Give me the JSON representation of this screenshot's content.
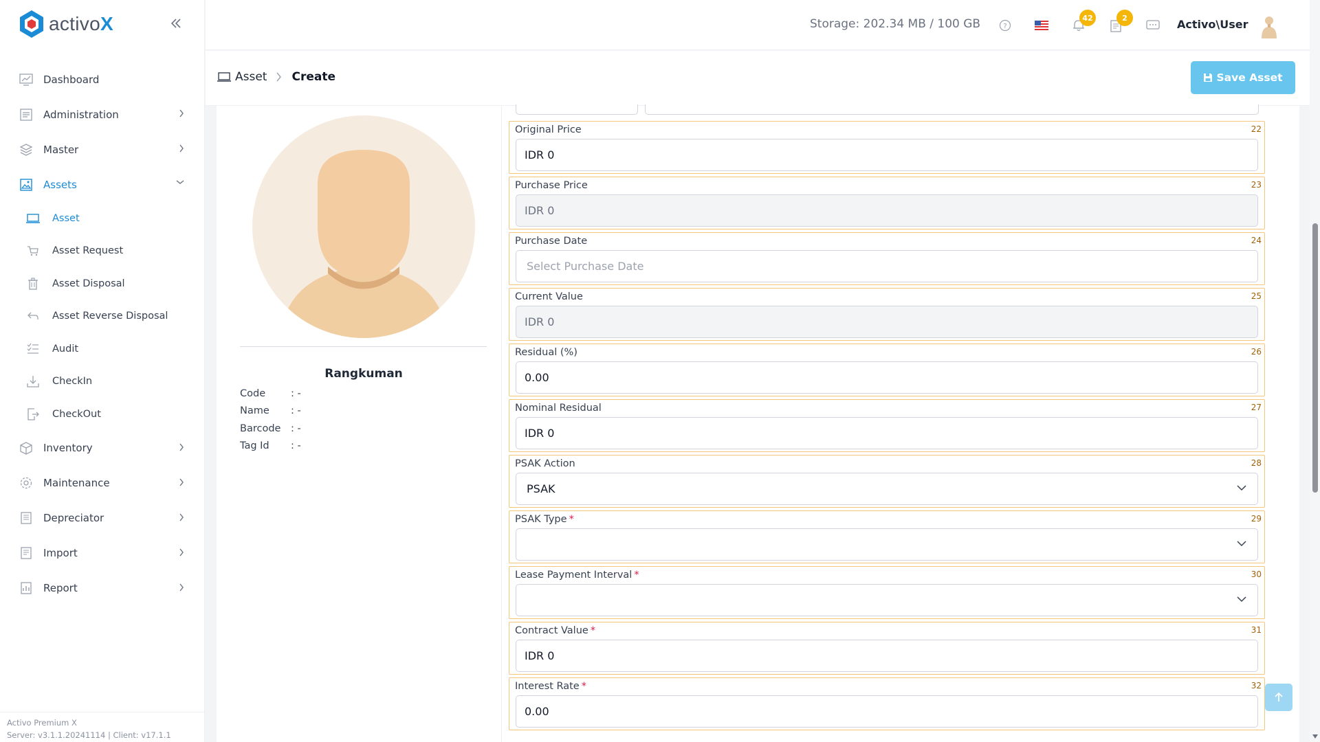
{
  "app": {
    "logo_text": "activo",
    "logo_x": "X",
    "brand_color": "#1c8bd6"
  },
  "header": {
    "storage": "Storage: 202.34 MB / 100 GB",
    "notifications_count": "42",
    "tasks_count": "2",
    "user": "Activo\\User"
  },
  "sidebar": {
    "items": [
      {
        "label": "Dashboard",
        "icon": "chart-icon"
      },
      {
        "label": "Administration",
        "icon": "document-icon"
      },
      {
        "label": "Master",
        "icon": "layers-icon"
      },
      {
        "label": "Assets",
        "icon": "image-icon"
      },
      {
        "label": "Inventory",
        "icon": "box-icon"
      },
      {
        "label": "Maintenance",
        "icon": "settings-icon"
      },
      {
        "label": "Depreciator",
        "icon": "building-icon"
      },
      {
        "label": "Import",
        "icon": "import-icon"
      },
      {
        "label": "Report",
        "icon": "report-icon"
      }
    ],
    "sub_items": [
      {
        "label": "Asset",
        "icon": "laptop-icon"
      },
      {
        "label": "Asset Request",
        "icon": "cart-icon"
      },
      {
        "label": "Asset Disposal",
        "icon": "trash-icon"
      },
      {
        "label": "Asset Reverse Disposal",
        "icon": "undo-icon"
      },
      {
        "label": "Audit",
        "icon": "checklist-icon"
      },
      {
        "label": "CheckIn",
        "icon": "download-icon"
      },
      {
        "label": "CheckOut",
        "icon": "logout-icon"
      }
    ],
    "footer_line1": "Activo Premium X",
    "footer_line2": "Server: v3.1.1.20241114 | Client: v17.1.1"
  },
  "breadcrumb": {
    "root": "Asset",
    "current": "Create"
  },
  "toolbar": {
    "save_label": "Save Asset"
  },
  "summary": {
    "title": "Rangkuman",
    "rows": [
      {
        "key": "Code",
        "value": ": -"
      },
      {
        "key": "Name",
        "value": ": -"
      },
      {
        "key": "Barcode",
        "value": ": -"
      },
      {
        "key": "Tag Id",
        "value": ": -"
      }
    ]
  },
  "form": {
    "fields": [
      {
        "label": "Original Price",
        "num": "22",
        "value": "IDR 0"
      },
      {
        "label": "Purchase Price",
        "num": "23",
        "value": "IDR 0"
      },
      {
        "label": "Purchase Date",
        "num": "24",
        "placeholder": "Select Purchase Date"
      },
      {
        "label": "Current Value",
        "num": "25",
        "value": "IDR 0"
      },
      {
        "label": "Residual (%)",
        "num": "26",
        "value": "0.00"
      },
      {
        "label": "Nominal Residual",
        "num": "27",
        "value": "IDR 0"
      },
      {
        "label": "PSAK Action",
        "num": "28",
        "value": "PSAK"
      },
      {
        "label": "PSAK Type",
        "num": "29",
        "value": ""
      },
      {
        "label": "Lease Payment Interval",
        "num": "30",
        "value": ""
      },
      {
        "label": "Contract Value",
        "num": "31",
        "value": "IDR 0"
      },
      {
        "label": "Interest Rate",
        "num": "32",
        "value": "0.00"
      }
    ],
    "required_mark": "*"
  }
}
